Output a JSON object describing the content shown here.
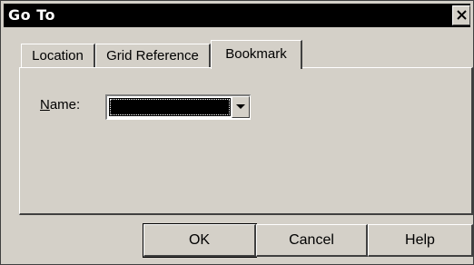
{
  "window": {
    "title": "Go To"
  },
  "tabs": [
    {
      "label": "Location",
      "selected": false
    },
    {
      "label": "Grid Reference",
      "selected": false
    },
    {
      "label": "Bookmark",
      "selected": true
    }
  ],
  "bookmark": {
    "name_label_mnemonic": "N",
    "name_label_rest": "ame:",
    "name_value": ""
  },
  "buttons": {
    "ok": "OK",
    "cancel": "Cancel",
    "help": "Help"
  },
  "icons": {
    "close": "close-icon",
    "dropdown": "chevron-down-icon"
  },
  "colors": {
    "face": "#d4d0c8",
    "titlebar": "#000000",
    "selection": "#000000"
  }
}
